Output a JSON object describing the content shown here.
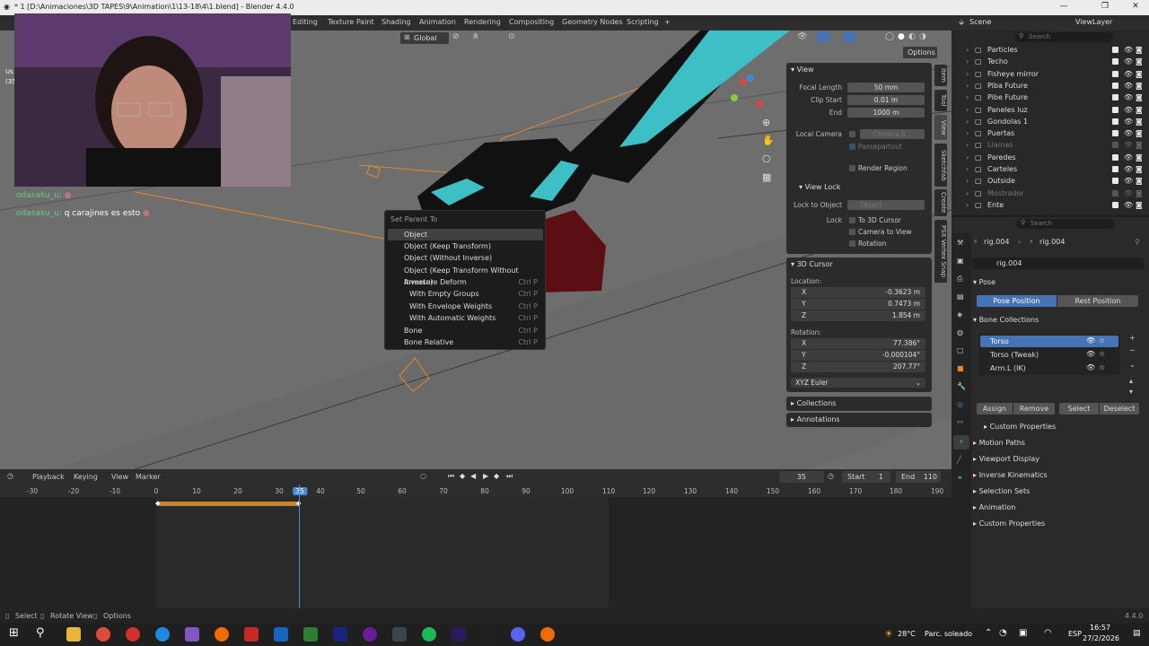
{
  "window": {
    "title": "* 1 [D:\\Animaciones\\3D TAPES\\9\\Animation\\1\\13-18\\4\\1.blend] - Blender 4.4.0",
    "btn_min": "—",
    "btn_max": "❐",
    "btn_close": "✕"
  },
  "workspaces": [
    "Editing",
    "Texture Paint",
    "Shading",
    "Animation",
    "Rendering",
    "Compositing",
    "Geometry Nodes",
    "Scripting",
    "+"
  ],
  "scene": {
    "scene_name": "Scene",
    "viewlayer": "ViewLayer"
  },
  "viewport": {
    "orientation": "Global",
    "options": "Options",
    "overlay_frag1": "Us",
    "overlay_frag2": "(35"
  },
  "chat": {
    "line1_user": "odasaku_u:",
    "line2_user": "odasaku_u:",
    "line2_msg": "q carajines es esto"
  },
  "menu": {
    "title": "Set Parent To",
    "items": [
      {
        "label": "Object",
        "shortcut": ""
      },
      {
        "label": "Object (Keep Transform)",
        "shortcut": ""
      },
      {
        "label": "Object (Without Inverse)",
        "shortcut": ""
      },
      {
        "label": "Object (Keep Transform Without Inverse)",
        "shortcut": ""
      },
      {
        "label": "Armature Deform",
        "shortcut": "Ctrl P"
      },
      {
        "label": "With Empty Groups",
        "shortcut": "Ctrl P"
      },
      {
        "label": "With Envelope Weights",
        "shortcut": "Ctrl P"
      },
      {
        "label": "With Automatic Weights",
        "shortcut": "Ctrl P"
      },
      {
        "label": "Bone",
        "shortcut": "Ctrl P"
      },
      {
        "label": "Bone Relative",
        "shortcut": "Ctrl P"
      }
    ]
  },
  "npanel": {
    "view_title": "View",
    "focal_label": "Focal Length",
    "focal": "50 mm",
    "clip_start_label": "Clip Start",
    "clip_start": "0.01 m",
    "end_label": "End",
    "clip_end": "1000 m",
    "local_camera_label": "Local Camera",
    "local_camera": "Camera.0...",
    "passepartout": "Passepartout",
    "render_region": "Render Region",
    "viewlock_title": "View Lock",
    "lock_obj_label": "Lock to Object",
    "lock_obj": "Object",
    "lock_label": "Lock",
    "to_cursor": "To 3D Cursor",
    "cam_to_view": "Camera to View",
    "rotation": "Rotation",
    "cursor_title": "3D Cursor",
    "location_label": "Location:",
    "x_label": "X",
    "y_label": "Y",
    "z_label": "Z",
    "loc_x": "-0.3623 m",
    "loc_y": "0.7473 m",
    "loc_z": "1.854 m",
    "rotation_label": "Rotation:",
    "rot_x": "77.386°",
    "rot_y": "-0.000104°",
    "rot_z": "207.77°",
    "euler": "XYZ Euler",
    "collections": "Collections",
    "annotations": "Annotations"
  },
  "sidetabs": [
    "Item",
    "Tool",
    "View",
    "Sketchfab",
    "Create",
    "PSX Vertex Snap"
  ],
  "outliner": {
    "search": "Search",
    "items": [
      {
        "name": "Particles",
        "dim": false
      },
      {
        "name": "Techo",
        "dim": false
      },
      {
        "name": "Fisheye mirror",
        "dim": false
      },
      {
        "name": "Piba Future",
        "dim": false
      },
      {
        "name": "Pibe Future",
        "dim": false
      },
      {
        "name": "Paneles luz",
        "dim": false
      },
      {
        "name": "Gondolas 1",
        "dim": false
      },
      {
        "name": "Puertas",
        "dim": false
      },
      {
        "name": "Llamas",
        "dim": true
      },
      {
        "name": "Paredes",
        "dim": false
      },
      {
        "name": "Carteles",
        "dim": false
      },
      {
        "name": "Outside",
        "dim": false
      },
      {
        "name": "Mostrador",
        "dim": true
      },
      {
        "name": "Ente",
        "dim": false
      }
    ]
  },
  "props": {
    "search": "Search",
    "breadcrumb1": "rig.004",
    "breadcrumb2": "rig.004",
    "name": "rig.004",
    "pose": "Pose",
    "pose_position": "Pose Position",
    "rest_position": "Rest Position",
    "bone_collections": "Bone Collections",
    "collections": [
      "Torso",
      "Torso (Tweak)",
      "Arm.L (IK)"
    ],
    "assign": "Assign",
    "remove": "Remove",
    "select": "Select",
    "deselect": "Deselect",
    "sections": [
      "Custom Properties",
      "Motion Paths",
      "Viewport Display",
      "Inverse Kinematics",
      "Selection Sets",
      "Animation",
      "Custom Properties"
    ]
  },
  "timeline": {
    "playback": "Playback",
    "keying": "Keying",
    "view": "View",
    "marker": "Marker",
    "current_frame": "35",
    "start_label": "Start",
    "start": "1",
    "end_label": "End",
    "end": "110",
    "ticks": [
      "-30",
      "-20",
      "-10",
      "0",
      "10",
      "20",
      "30",
      "35",
      "40",
      "50",
      "60",
      "70",
      "80",
      "90",
      "100",
      "110",
      "120",
      "130",
      "140",
      "150",
      "160",
      "170",
      "180",
      "190"
    ]
  },
  "statusbar": {
    "select": "Select",
    "rotate": "Rotate View",
    "options": "Options",
    "version": "4.4.0"
  },
  "taskbar": {
    "weather": "28°C",
    "weather_text": "Parc. soleado",
    "lang": "ESP",
    "time": "16:57",
    "date": "27/2/2026"
  },
  "colors": {
    "accent": "#4772b3",
    "orange": "#e8862a",
    "cyan": "#3ebfc6",
    "playhead": "#4b8ad9"
  }
}
